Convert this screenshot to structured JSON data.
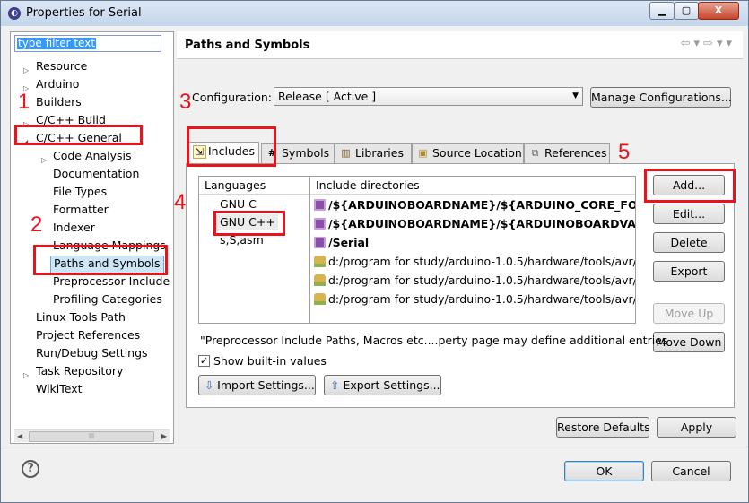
{
  "window": {
    "title": "Properties for Serial",
    "close_glyph": "X"
  },
  "filter": {
    "value": "type filter text"
  },
  "tree": [
    {
      "label": "Resource",
      "expand": true
    },
    {
      "label": "Arduino",
      "expand": true
    },
    {
      "label": "Builders",
      "expand": false
    },
    {
      "label": "C/C++ Build",
      "expand": true
    },
    {
      "label": "C/C++ General",
      "expand": true
    },
    {
      "label": "Code Analysis",
      "expand": true
    },
    {
      "label": "Documentation"
    },
    {
      "label": "File Types"
    },
    {
      "label": "Formatter"
    },
    {
      "label": "Indexer"
    },
    {
      "label": "Language Mappings"
    },
    {
      "label": "Paths and Symbols"
    },
    {
      "label": "Preprocessor Include"
    },
    {
      "label": "Profiling Categories"
    },
    {
      "label": "Linux Tools Path"
    },
    {
      "label": "Project References"
    },
    {
      "label": "Run/Debug Settings"
    },
    {
      "label": "Task Repository",
      "expand": true
    },
    {
      "label": "WikiText"
    }
  ],
  "page": {
    "title": "Paths and Symbols"
  },
  "config": {
    "label": "Configuration:",
    "value": "Release  [ Active ]",
    "manage_label": "Manage Configurations..."
  },
  "tabs": [
    "Includes",
    "Symbols",
    "Libraries",
    "Source Location",
    "References"
  ],
  "languages": {
    "header": "Languages",
    "items": [
      "GNU C",
      "GNU C++",
      "s,S,asm"
    ]
  },
  "includes": {
    "header": "Include directories",
    "rows": [
      {
        "text": "/${ARDUINOBOARDNAME}/${ARDUINO_CORE_FOLDE...",
        "kind": "workspace",
        "bold": true
      },
      {
        "text": "/${ARDUINOBOARDNAME}/${ARDUINOBOARDVARIA...",
        "kind": "workspace",
        "bold": true
      },
      {
        "text": "/Serial",
        "kind": "workspace",
        "bold": true
      },
      {
        "text": "d:/program for study/arduino-1.0.5/hardware/tools/avr/...",
        "kind": "filesystem",
        "bold": false
      },
      {
        "text": "d:/program for study/arduino-1.0.5/hardware/tools/avr/...",
        "kind": "filesystem",
        "bold": false
      },
      {
        "text": "d:/program for study/arduino-1.0.5/hardware/tools/avr/...",
        "kind": "filesystem",
        "bold": false
      }
    ]
  },
  "side_buttons": {
    "add": "Add...",
    "edit": "Edit...",
    "delete": "Delete",
    "export": "Export",
    "move_up": "Move Up",
    "move_down": "Move Down"
  },
  "note": "\"Preprocessor Include Paths, Macros etc....perty page may define additional entries",
  "show_builtin": {
    "label": "Show built-in values",
    "checked": true
  },
  "import_label": "Import Settings...",
  "export_label": "Export Settings...",
  "restore_label": "Restore Defaults",
  "apply_label": "Apply",
  "ok_label": "OK",
  "cancel_label": "Cancel",
  "annotations": {
    "n1": "1",
    "n2": "2",
    "n3": "3",
    "n4": "4",
    "n5": "5"
  },
  "colors": {
    "annotation": "#e8131b",
    "selection": "#3399ff"
  }
}
